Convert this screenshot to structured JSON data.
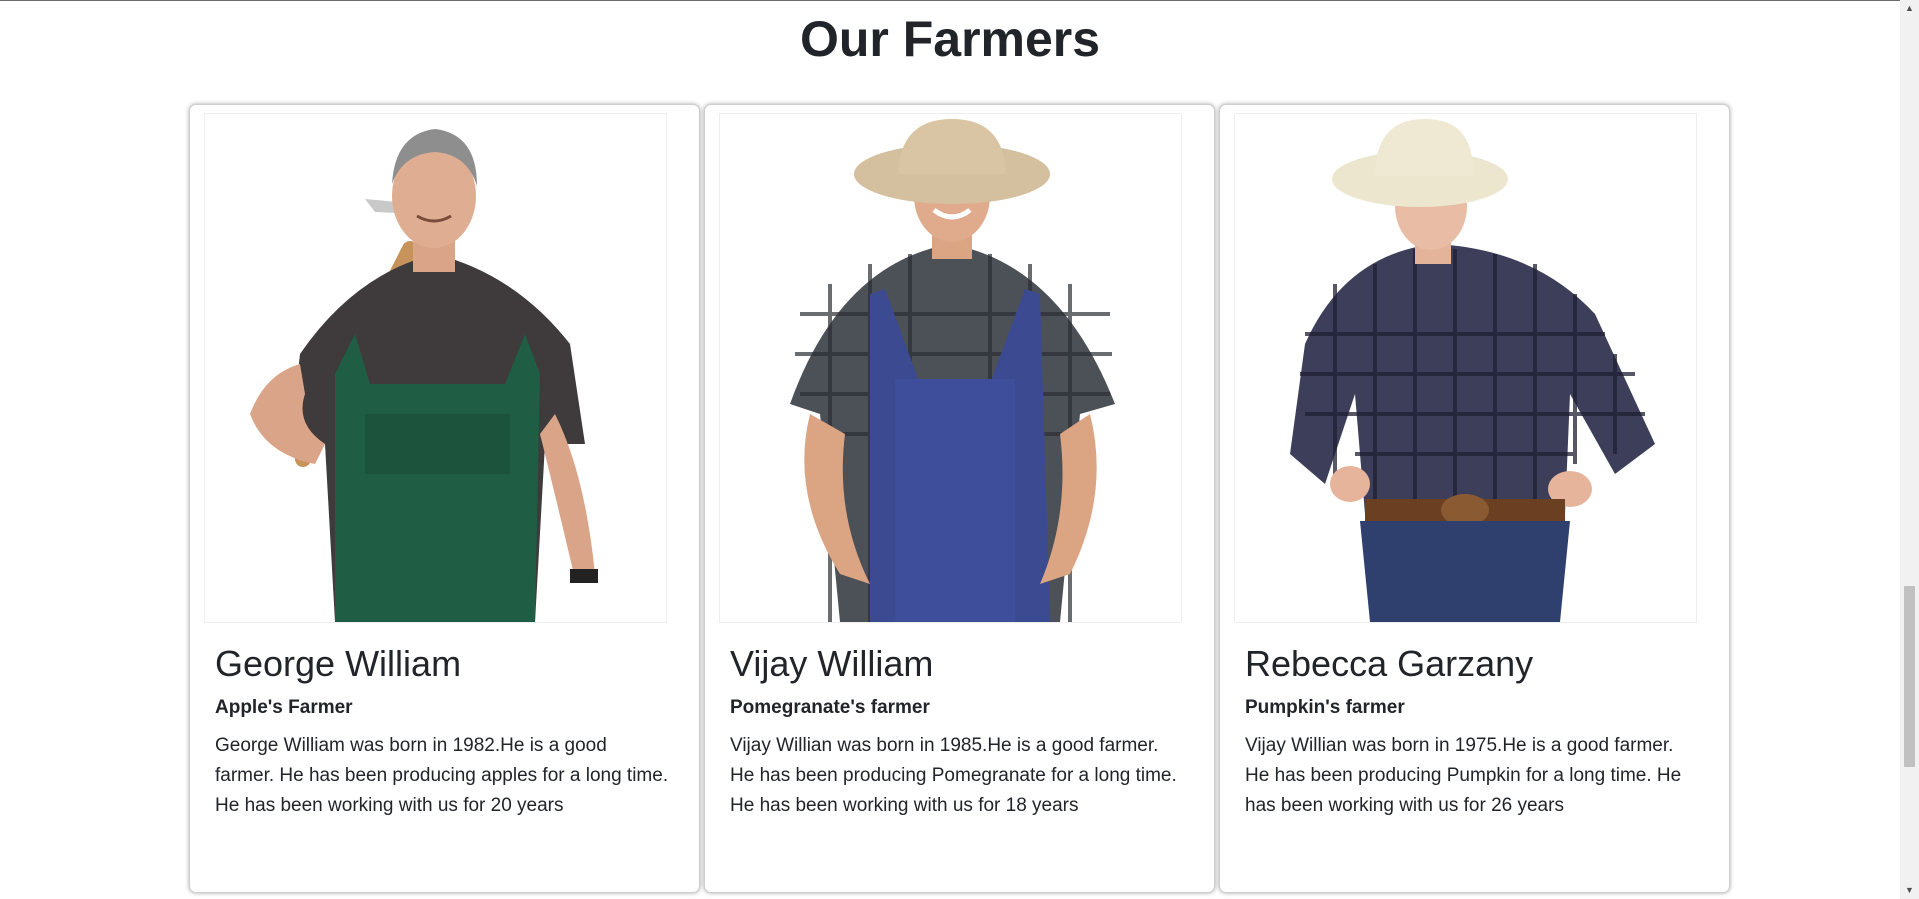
{
  "section": {
    "title": "Our Farmers"
  },
  "farmers": [
    {
      "name": "George William",
      "role": "Apple's Farmer",
      "bio": "George William was born in 1982.He is a good farmer. He has been producing apples for a long time. He has been working with us for 20 years"
    },
    {
      "name": "Vijay William",
      "role": "Pomegranate's farmer",
      "bio": "Vijay Willian was born in 1985.He is a good farmer. He has been producing Pomegranate for a long time. He has been working with us for 18 years"
    },
    {
      "name": "Rebecca Garzany",
      "role": "Pumpkin's farmer",
      "bio": "Vijay Willian was born in 1975.He is a good farmer. He has been producing Pumpkin for a long time. He has been working with us for 26 years"
    }
  ],
  "scrollbar": {
    "up_icon": "triangle-up-icon",
    "down_icon": "triangle-down-icon"
  }
}
